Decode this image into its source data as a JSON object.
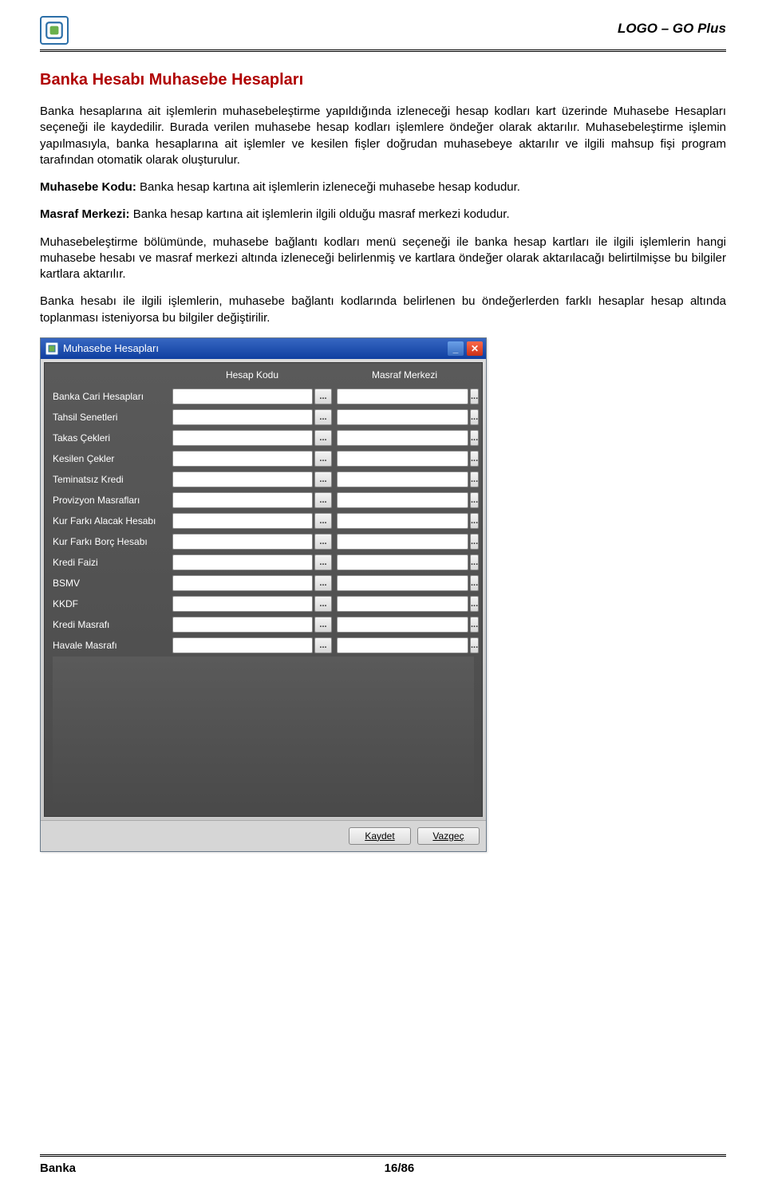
{
  "header": {
    "product": "LOGO – GO Plus"
  },
  "section": {
    "title": "Banka Hesabı Muhasebe Hesapları"
  },
  "paragraphs": {
    "p1": "Banka hesaplarına ait işlemlerin muhasebeleştirme yapıldığında izleneceği hesap kodları kart üzerinde Muhasebe Hesapları seçeneği ile kaydedilir. Burada verilen muhasebe hesap kodları işlemlere öndeğer olarak aktarılır. Muhasebeleştirme işlemin yapılmasıyla, banka hesaplarına ait işlemler ve kesilen fişler doğrudan muhasebeye aktarılır ve ilgili mahsup fişi program tarafından otomatik olarak oluşturulur.",
    "p2_label": "Muhasebe Kodu:",
    "p2_text": " Banka hesap kartına ait işlemlerin izleneceği muhasebe hesap kodudur.",
    "p3_label": "Masraf Merkezi:",
    "p3_text": " Banka hesap kartına ait işlemlerin ilgili olduğu masraf merkezi kodudur.",
    "p4": "Muhasebeleştirme bölümünde, muhasebe bağlantı kodları menü seçeneği ile banka hesap kartları ile ilgili işlemlerin hangi muhasebe hesabı ve masraf merkezi altında izleneceği belirlenmiş ve kartlara öndeğer olarak aktarılacağı belirtilmişse bu bilgiler kartlara aktarılır.",
    "p5": "Banka hesabı ile ilgili işlemlerin, muhasebe bağlantı kodlarında belirlenen bu öndeğerlerden farklı hesaplar hesap altında toplanması isteniyorsa bu bilgiler değiştirilir."
  },
  "dialog": {
    "title": "Muhasebe Hesapları",
    "columns": {
      "account_code": "Hesap Kodu",
      "cost_center": "Masraf Merkezi"
    },
    "rows": [
      "Banka Cari Hesapları",
      "Tahsil Senetleri",
      "Takas Çekleri",
      "Kesilen Çekler",
      "Teminatsız Kredi",
      "Provizyon Masrafları",
      "Kur Farkı Alacak Hesabı",
      "Kur Farkı Borç Hesabı",
      "Kredi Faizi",
      "BSMV",
      "KKDF",
      "Kredi Masrafı",
      "Havale Masrafı"
    ],
    "lookup_label": "...",
    "buttons": {
      "save": "Kaydet",
      "cancel": "Vazgeç"
    }
  },
  "footer": {
    "left": "Banka",
    "page": "16/86"
  }
}
